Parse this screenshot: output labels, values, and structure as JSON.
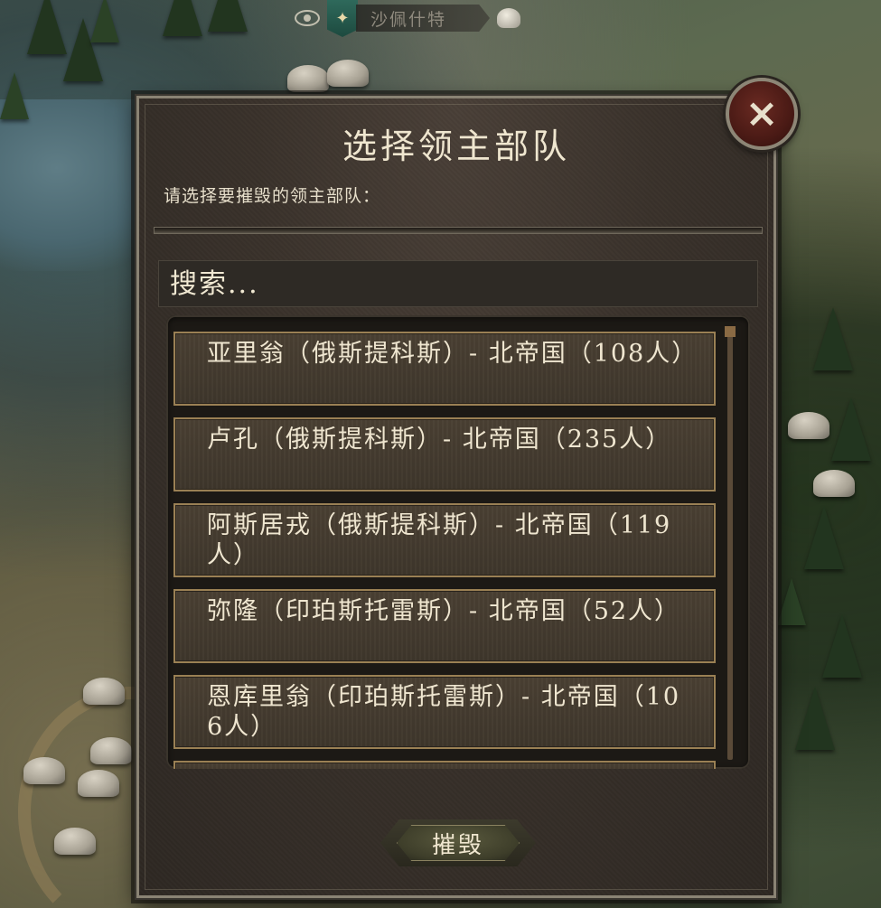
{
  "map": {
    "location_name": "沙佩什特"
  },
  "dialog": {
    "title": "选择领主部队",
    "subtitle": "请选择要摧毁的领主部队：",
    "search_placeholder": "搜索...",
    "items": [
      {
        "label": "亚里翁（俄斯提科斯）- 北帝国（108人）"
      },
      {
        "label": "卢孔（俄斯提科斯）- 北帝国（235人）"
      },
      {
        "label": "阿斯居戎（俄斯提科斯）- 北帝国（119人）"
      },
      {
        "label": "弥隆（印珀斯托雷斯）- 北帝国（52人）"
      },
      {
        "label": "恩库里翁（印珀斯托雷斯）- 北帝国（106人）"
      }
    ],
    "destroy_label": "摧毁",
    "close_icon": "×",
    "scroll_position": 0
  },
  "colors": {
    "dialog_bg": "#3a322b",
    "item_border": "#9a8054",
    "text": "#efe6d0",
    "close_bg": "#4a1a15"
  }
}
